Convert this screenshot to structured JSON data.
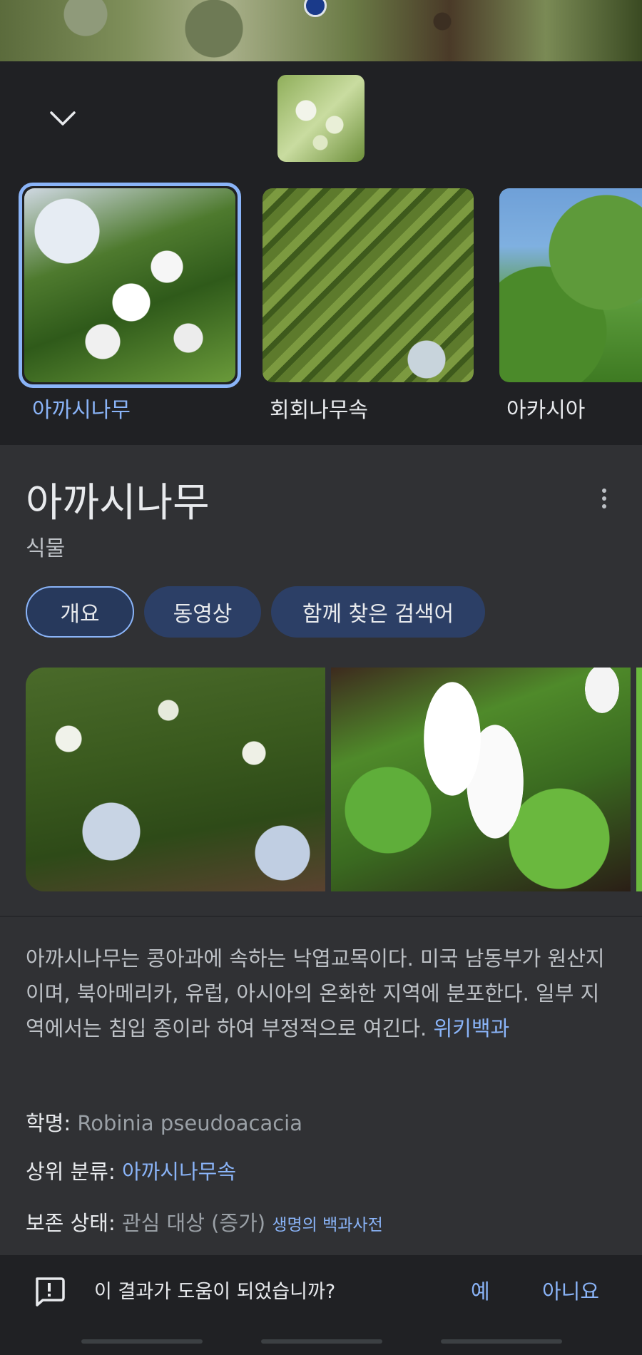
{
  "matches": [
    {
      "label": "아까시나무"
    },
    {
      "label": "회회나무속"
    },
    {
      "label": "아카시아"
    }
  ],
  "knowledge_panel": {
    "title": "아까시나무",
    "subtitle": "식물",
    "chips": [
      "개요",
      "동영상",
      "함께 찾은 검색어"
    ],
    "description": "아까시나무는 콩아과에 속하는 낙엽교목이다. 미국 남동부가 원산지이며, 북아메리카, 유럽, 아시아의 온화한 지역에 분포한다. 일부 지역에서는 침입 종이라 하여 부정적으로 여긴다. ",
    "source_link": "위키백과",
    "facts": [
      {
        "key": "학명: ",
        "value": "Robinia pseudoacacia"
      },
      {
        "key": "상위 분류: ",
        "link": "아까시나무속"
      },
      {
        "key": "보존 상태: ",
        "value": "관심 대상 (증가) ",
        "source": "생명의 백과사전"
      }
    ]
  },
  "feedback": {
    "question": "이 결과가 도움이 되었습니까?",
    "yes": "예",
    "no": "아니요"
  },
  "colors": {
    "background": "#202124",
    "panel": "#303134",
    "accent": "#8ab4f8",
    "chip": "#2c3f66"
  },
  "icons": [
    "chevron-down-icon",
    "more-vert-icon",
    "feedback-icon"
  ]
}
